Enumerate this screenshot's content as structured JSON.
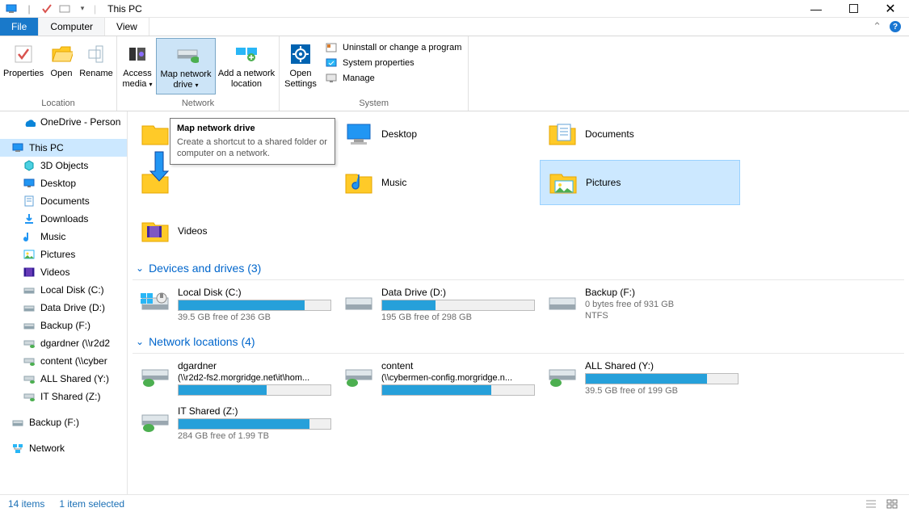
{
  "window": {
    "title": "This PC"
  },
  "tabs": {
    "file": "File",
    "computer": "Computer",
    "view": "View"
  },
  "ribbon": {
    "location": {
      "label": "Location",
      "properties": "Properties",
      "open": "Open",
      "rename": "Rename"
    },
    "network": {
      "label": "Network",
      "access_media": "Access media",
      "map_drive": "Map network drive",
      "add_loc": "Add a network location"
    },
    "system": {
      "label": "System",
      "open_settings": "Open Settings",
      "uninstall": "Uninstall or change a program",
      "sys_props": "System properties",
      "manage": "Manage"
    }
  },
  "tooltip": {
    "title": "Map network drive",
    "desc": "Create a shortcut to a shared folder or computer on a network."
  },
  "sidebar": [
    {
      "label": "OneDrive - Person",
      "icon": "onedrive"
    },
    {
      "label": "This PC",
      "icon": "pc",
      "selected": true,
      "root": true
    },
    {
      "label": "3D Objects",
      "icon": "3d"
    },
    {
      "label": "Desktop",
      "icon": "desktop"
    },
    {
      "label": "Documents",
      "icon": "docs"
    },
    {
      "label": "Downloads",
      "icon": "downloads"
    },
    {
      "label": "Music",
      "icon": "music"
    },
    {
      "label": "Pictures",
      "icon": "pictures"
    },
    {
      "label": "Videos",
      "icon": "videos"
    },
    {
      "label": "Local Disk (C:)",
      "icon": "disk"
    },
    {
      "label": "Data Drive (D:)",
      "icon": "disk"
    },
    {
      "label": "Backup (F:)",
      "icon": "disk"
    },
    {
      "label": "dgardner (\\\\r2d2",
      "icon": "netdrive"
    },
    {
      "label": "content (\\\\cyber",
      "icon": "netdrive"
    },
    {
      "label": "ALL Shared (Y:)",
      "icon": "netdrive"
    },
    {
      "label": "IT Shared (Z:)",
      "icon": "netdrive"
    },
    {
      "label": "Backup (F:)",
      "icon": "disk",
      "root": true
    },
    {
      "label": "Network",
      "icon": "network",
      "root": true
    }
  ],
  "folders": [
    {
      "label": " ",
      "icon": "folder-shortcut"
    },
    {
      "label": "Desktop",
      "icon": "desktop"
    },
    {
      "label": "Documents",
      "icon": "docs"
    },
    {
      "label": "",
      "icon": "folder"
    },
    {
      "label": "Music",
      "icon": "music"
    },
    {
      "label": "Pictures",
      "icon": "pictures",
      "selected": true
    },
    {
      "label": "Videos",
      "icon": "videos"
    }
  ],
  "sections": {
    "drives_head": "Devices and drives (3)",
    "net_head": "Network locations (4)"
  },
  "drives": [
    {
      "name": "Local Disk (C:)",
      "free": "39.5 GB free of 236 GB",
      "pct": 83,
      "icon": "windisk"
    },
    {
      "name": "Data Drive (D:)",
      "free": "195 GB free of 298 GB",
      "pct": 35,
      "icon": "disk"
    },
    {
      "name": "Backup (F:)",
      "free": "0 bytes free of 931 GB",
      "fs": "NTFS",
      "nobar": true,
      "icon": "disk"
    }
  ],
  "netlocs": [
    {
      "name": "dgardner",
      "sub": "(\\\\r2d2-fs2.morgridge.net\\it\\hom...",
      "pct": 58,
      "icon": "netdrive"
    },
    {
      "name": "content",
      "sub": "(\\\\cybermen-config.morgridge.n...",
      "pct": 72,
      "icon": "netdrive"
    },
    {
      "name": "ALL Shared (Y:)",
      "free": "39.5 GB free of 199 GB",
      "pct": 80,
      "icon": "netdrive"
    },
    {
      "name": "IT Shared (Z:)",
      "free": "284 GB free of 1.99 TB",
      "pct": 86,
      "icon": "netdrive"
    }
  ],
  "status": {
    "items": "14 items",
    "selected": "1 item selected"
  }
}
